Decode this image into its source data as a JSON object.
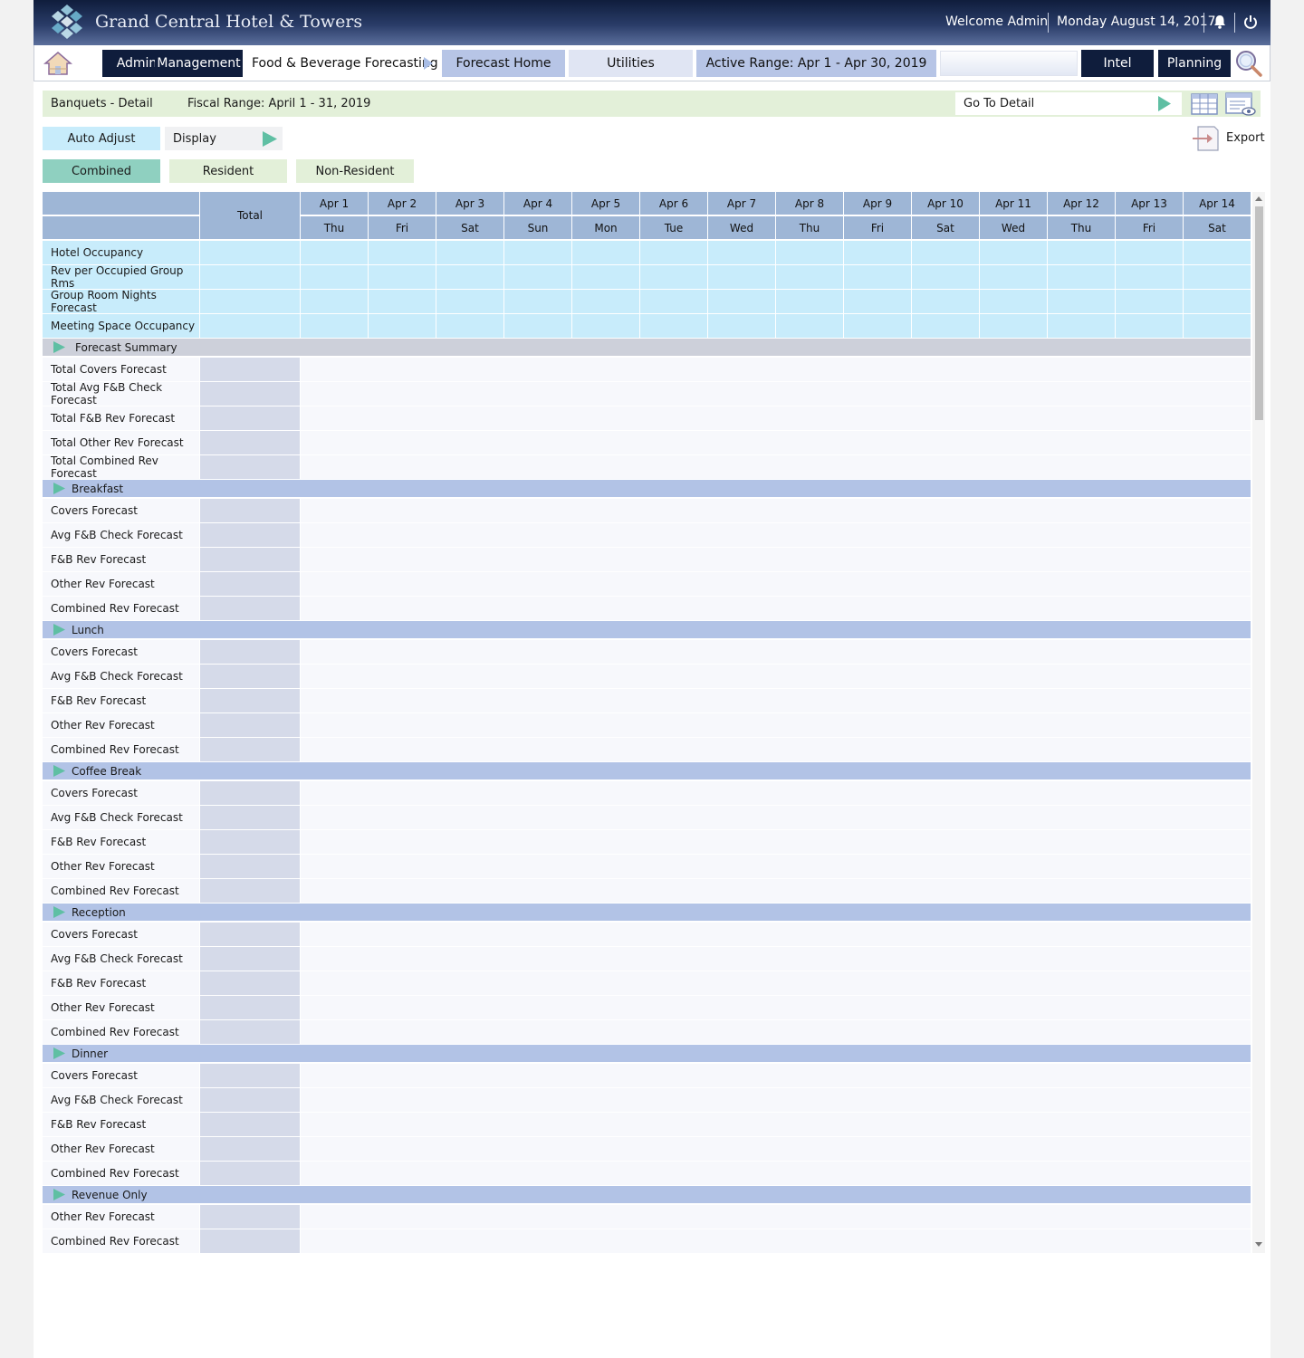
{
  "header": {
    "title": "Grand Central Hotel & Towers",
    "welcome": "Welcome Admin",
    "date": "Monday August 14, 2017"
  },
  "nav": {
    "admin": "Admin",
    "management": "Management",
    "module": "Food & Beverage Forecasting",
    "forecast_home": "Forecast Home",
    "utilities": "Utilities",
    "active_range": "Active Range: Apr 1 -  Apr 30, 2019",
    "intel": "Intel",
    "planning": "Planning"
  },
  "detail_bar": {
    "title": "Banquets - Detail",
    "fiscal_range": "Fiscal Range: April 1 - 31, 2019",
    "goto_label": "Go To Detail"
  },
  "toolbar": {
    "auto_adjust": "Auto Adjust",
    "display": "Display",
    "export": "Export"
  },
  "tabs": [
    "Combined",
    "Resident",
    "Non-Resident"
  ],
  "grid": {
    "total_header": "Total",
    "dates": [
      "Apr 1",
      "Apr 2",
      "Apr 3",
      "Apr 4",
      "Apr 5",
      "Apr 6",
      "Apr 7",
      "Apr 8",
      "Apr 9",
      "Apr 10",
      "Apr 11",
      "Apr 12",
      "Apr 13",
      "Apr 14"
    ],
    "days": [
      "Thu",
      "Fri",
      "Sat",
      "Sun",
      "Mon",
      "Tue",
      "Wed",
      "Thu",
      "Fri",
      "Sat",
      "Wed",
      "Thu",
      "Fri",
      "Sat"
    ],
    "kpi_rows": [
      "Hotel Occupancy",
      "Rev per Occupied Group Rms",
      "Group Room Nights Forecast",
      "Meeting Space Occupancy"
    ],
    "sections": [
      {
        "name": "Forecast Summary",
        "rows": [
          "Total Covers Forecast",
          "Total Avg F&B Check Forecast",
          "Total F&B Rev Forecast",
          "Total Other Rev Forecast",
          "Total Combined Rev Forecast"
        ]
      },
      {
        "name": "Breakfast",
        "rows": [
          "Covers Forecast",
          "Avg F&B Check Forecast",
          "F&B Rev Forecast",
          "Other Rev Forecast",
          "Combined Rev Forecast"
        ]
      },
      {
        "name": "Lunch",
        "rows": [
          "Covers Forecast",
          "Avg F&B Check Forecast",
          "F&B Rev Forecast",
          "Other Rev Forecast",
          "Combined Rev Forecast"
        ]
      },
      {
        "name": "Coffee Break",
        "rows": [
          "Covers Forecast",
          "Avg F&B Check Forecast",
          "F&B Rev Forecast",
          "Other Rev Forecast",
          "Combined Rev Forecast"
        ]
      },
      {
        "name": "Reception",
        "rows": [
          "Covers Forecast",
          "Avg F&B Check Forecast",
          "F&B Rev Forecast",
          "Other Rev Forecast",
          "Combined Rev Forecast"
        ]
      },
      {
        "name": "Dinner",
        "rows": [
          "Covers Forecast",
          "Avg F&B Check Forecast",
          "F&B Rev Forecast",
          "Other Rev Forecast",
          "Combined Rev Forecast"
        ]
      },
      {
        "name": "Revenue Only",
        "rows": [
          "Other Rev Forecast",
          "Combined Rev Forecast"
        ]
      }
    ]
  },
  "colors": {
    "summary_section_bg": "#cdd0da",
    "section_bg": "#b2c3e6",
    "kpi_bg": "#c8ecfb",
    "header_bg": "#9eb6d6",
    "accent_arrow": "#5fbfa3"
  }
}
